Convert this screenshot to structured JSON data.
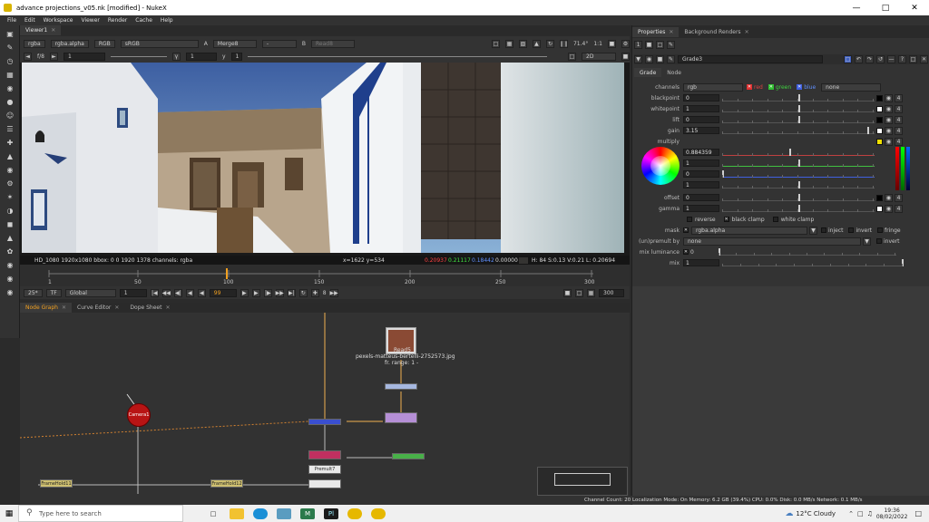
{
  "window": {
    "title": "advance projections_v05.nk [modified] - NukeX"
  },
  "menu": [
    "File",
    "Edit",
    "Workspace",
    "Viewer",
    "Render",
    "Cache",
    "Help"
  ],
  "viewer": {
    "tab_label": "Viewer1",
    "channels": "rgba",
    "alpha": "rgba.alpha",
    "colorspace_rgb": "RGB",
    "lut": "sRGB",
    "input_a_label": "A",
    "input_a": "Merge8",
    "input_op": "-",
    "input_b_label": "B",
    "input_b": "Read8",
    "zoom": "71.4°",
    "ratio": "1:1",
    "fstop": "f/8",
    "frame_step": "1",
    "gain_value": "1",
    "y_label": "y",
    "gamma_value": "1",
    "view_mode": "2D",
    "status_left": "HD_1080 1920x1080  bbox: 0 0 1920 1378 channels: rgba",
    "status_coords": "x=1622 y=534",
    "status_r": "0.20937",
    "status_g": "0.21117",
    "status_b": "0.18442",
    "status_a": "0.00000",
    "status_hsvl": "H: 84 S:0.13 V:0.21  L: 0.20694"
  },
  "timeline": {
    "ticks": [
      "1",
      "50",
      "100",
      "150",
      "200",
      "250",
      "300"
    ],
    "current_frame": "99",
    "fps": "25*",
    "tf": "TF",
    "scope": "Global",
    "in_frame": "1",
    "out_frame": "300",
    "step": "8",
    "end_value": "300"
  },
  "node_tabs": [
    "Node Graph",
    "Curve Editor",
    "Dope Sheet"
  ],
  "nodes": {
    "read5_title": "Read5",
    "read5_file": "pexels-matteus-bertelli-2752573.jpg",
    "read5_range": "fr. range: 1 -",
    "camera": "Camera1",
    "premult": "Premult7",
    "framehold11": "FrameHold11",
    "framehold12": "FrameHold12"
  },
  "properties": {
    "tabs": [
      "Properties",
      "Background Renders"
    ],
    "node_name": "Grade3",
    "subtabs": [
      "Grade",
      "Node"
    ],
    "channels_label": "channels",
    "channels_value": "rgb",
    "chk_red": "red",
    "chk_green": "green",
    "chk_blue": "blue",
    "channels_extra": "none",
    "knobs": [
      {
        "label": "blackpoint",
        "value": "0"
      },
      {
        "label": "whitepoint",
        "value": "1"
      },
      {
        "label": "lift",
        "value": "0"
      },
      {
        "label": "gain",
        "value": "3.15"
      }
    ],
    "multiply_label": "multiply",
    "multiply_values": [
      "0.884359",
      "1",
      "0",
      "1"
    ],
    "offset": {
      "label": "offset",
      "value": "0"
    },
    "gamma": {
      "label": "gamma",
      "value": "1"
    },
    "reverse": "reverse",
    "black_clamp": "black clamp",
    "white_clamp": "white clamp",
    "mask_label": "mask",
    "mask_value": "rgba.alpha",
    "inject": "inject",
    "invert": "invert",
    "fringe": "fringe",
    "unpremult_label": "(un)premult by",
    "unpremult_value": "none",
    "invert2": "invert",
    "mix_lum_label": "mix luminance",
    "mix_lum_value": "0",
    "mix_label": "mix",
    "mix_value": "1",
    "slider_ticks": [
      "0",
      "0.1",
      "0.2",
      "0.3",
      "0.4",
      "0.5",
      "0.6",
      "0.7",
      "0.8",
      "0.9",
      "1"
    ]
  },
  "status_line": "Channel Count: 20  Localization Mode: On  Memory: 6.2 GB (39.4%)  CPU: 0.0%  Disk: 0.0 MB/s  Network: 0.1 MB/s",
  "taskbar": {
    "search_placeholder": "Type here to search",
    "weather": "12°C  Cloudy",
    "time": "19:36",
    "date": "08/02/2022"
  }
}
